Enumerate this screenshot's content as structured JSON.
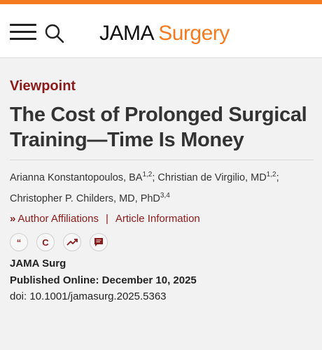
{
  "colors": {
    "accent": "#f47b20",
    "section": "#8b1a1a",
    "background": "#f2f2f2"
  },
  "header": {
    "menu_icon": "hamburger-menu-icon",
    "search_icon": "search-icon",
    "logo_journal": "JAMA",
    "logo_specialty": "Surgery"
  },
  "article": {
    "section": "Viewpoint",
    "title": "The Cost of Prolonged Surgical Training—Time Is Money",
    "authors": [
      {
        "name": "Arianna Konstantopoulos, BA",
        "affil": "1,2",
        "sep": ";"
      },
      {
        "name": "Christian de Virgilio, MD",
        "affil": "1,2",
        "sep": ";"
      },
      {
        "name": "Christopher P. Childers, MD, PhD",
        "affil": "3,4",
        "sep": ""
      }
    ],
    "links": {
      "affiliations": "Author Affiliations",
      "separator": "|",
      "information": "Article Information"
    },
    "tools": [
      {
        "icon": "quote-icon",
        "glyph": "“"
      },
      {
        "icon": "copyright-icon",
        "glyph": "C"
      },
      {
        "icon": "trending-up-icon",
        "glyph": ""
      },
      {
        "icon": "comment-icon",
        "glyph": ""
      }
    ],
    "journal": "JAMA Surg",
    "published": "Published Online: December 10, 2025",
    "doi": "doi: 10.1001/jamasurg.2025.5363"
  }
}
